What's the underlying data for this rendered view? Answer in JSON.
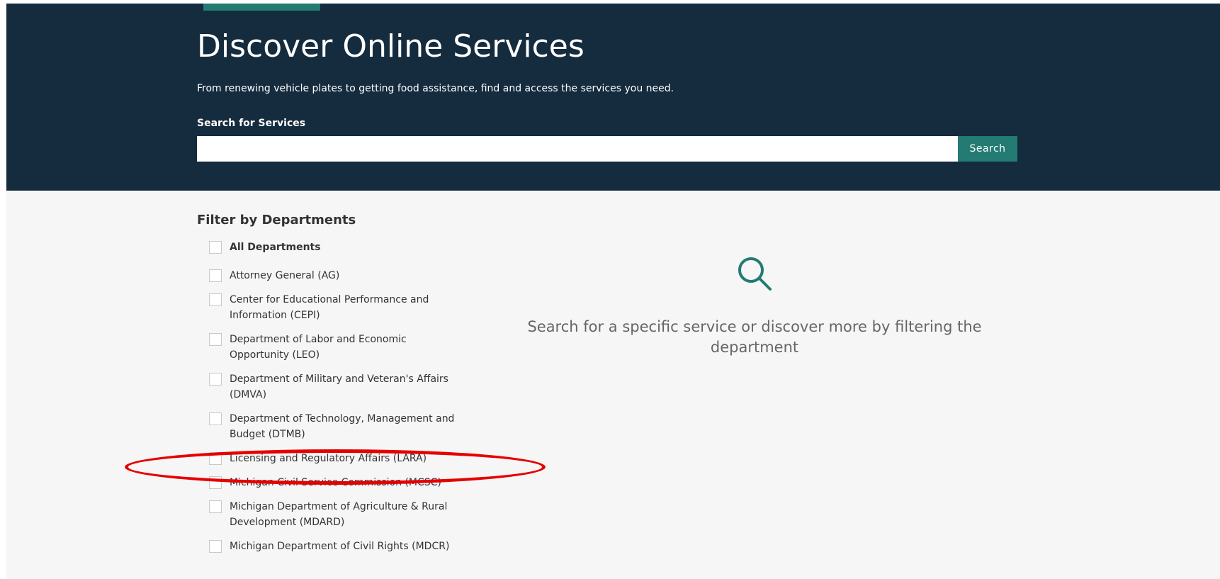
{
  "hero": {
    "title": "Discover Online Services",
    "subtitle": "From renewing vehicle plates to getting food assistance, find and access the services you need.",
    "search_label": "Search for Services",
    "search_value": "",
    "search_button": "Search"
  },
  "filters": {
    "title": "Filter by Departments",
    "departments": [
      {
        "label": "All Departments",
        "checked": false,
        "bold": true
      },
      {
        "label": "Attorney General (AG)",
        "checked": false
      },
      {
        "label": "Center for Educational Performance and Information (CEPI)",
        "checked": false
      },
      {
        "label": "Department of Labor and Economic Opportunity (LEO)",
        "checked": false
      },
      {
        "label": "Department of Military and Veteran's Affairs (DMVA)",
        "checked": false
      },
      {
        "label": "Department of Technology, Management and Budget (DTMB)",
        "checked": false
      },
      {
        "label": "Licensing and Regulatory Affairs (LARA)",
        "checked": false,
        "annotated": true
      },
      {
        "label": "Michigan Civil Service Commission (MCSC)",
        "checked": false
      },
      {
        "label": "Michigan Department of Agriculture & Rural Development (MDARD)",
        "checked": false
      },
      {
        "label": "Michigan Department of Civil Rights (MDCR)",
        "checked": false
      }
    ]
  },
  "empty_state": {
    "icon": "search-icon",
    "message": "Search for a specific service or discover more by filtering the department"
  },
  "colors": {
    "hero_background": "#152b3e",
    "accent": "#237b73",
    "content_background": "#f6f6f6",
    "annotation": "#e60000"
  }
}
